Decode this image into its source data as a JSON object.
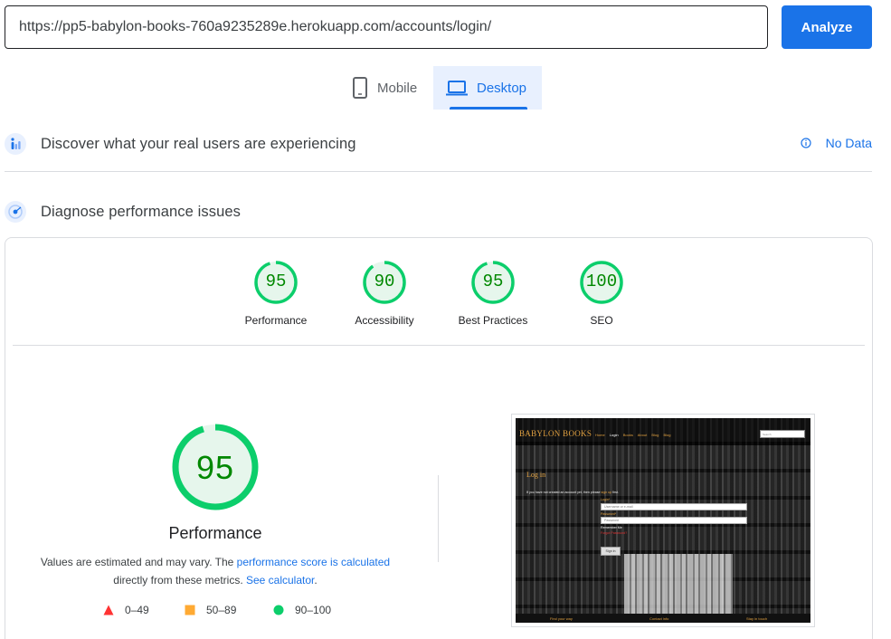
{
  "url_bar": {
    "value": "https://pp5-babylon-books-760a9235289e.herokuapp.com/accounts/login/",
    "analyze_label": "Analyze"
  },
  "device_tabs": [
    {
      "label": "Mobile",
      "icon": "phone-icon",
      "active": false
    },
    {
      "label": "Desktop",
      "icon": "laptop-icon",
      "active": true
    }
  ],
  "field_data": {
    "title": "Discover what your real users are experiencing",
    "status": "No Data",
    "icon": "users-chart-icon"
  },
  "lab_data": {
    "title": "Diagnose performance issues",
    "icon": "lab-target-icon"
  },
  "scores": [
    {
      "label": "Performance",
      "value": "95"
    },
    {
      "label": "Accessibility",
      "value": "90"
    },
    {
      "label": "Best Practices",
      "value": "95"
    },
    {
      "label": "SEO",
      "value": "100"
    }
  ],
  "main_score": {
    "value": "95",
    "label": "Performance",
    "desc_prefix": "Values are estimated and may vary. The ",
    "desc_link1": "performance score is calculated",
    "desc_middle": "directly from these metrics. ",
    "desc_link2": "See calculator",
    "desc_end": "."
  },
  "legend": [
    {
      "range": "0–49",
      "color": "#ff3333",
      "shape": "triangle"
    },
    {
      "range": "50–89",
      "color": "#ffaa33",
      "shape": "square"
    },
    {
      "range": "90–100",
      "color": "#0cce6b",
      "shape": "circle"
    }
  ],
  "colors": {
    "accent": "#1a73e8",
    "pass": "#0cce6b",
    "pass_text": "#008800"
  },
  "screenshot": {
    "brand": "BABYLON BOOKS",
    "nav": [
      "Home",
      "Login",
      "Books",
      "About",
      "Blog",
      "Blog"
    ],
    "search_placeholder": "Search",
    "heading": "Log in",
    "note_prefix": "If you have not created an account yet, then please ",
    "note_link": "sign up",
    "note_suffix": " first.",
    "login_label": "Login*",
    "login_placeholder": "Username or e-mail",
    "password_label": "Password*",
    "password_placeholder": "Password",
    "remember": "Remember Me",
    "forgot": "Forgot Password?",
    "signin": "Sign in",
    "footer": [
      "Find your way",
      "Contact info",
      "Stay in touch"
    ]
  }
}
